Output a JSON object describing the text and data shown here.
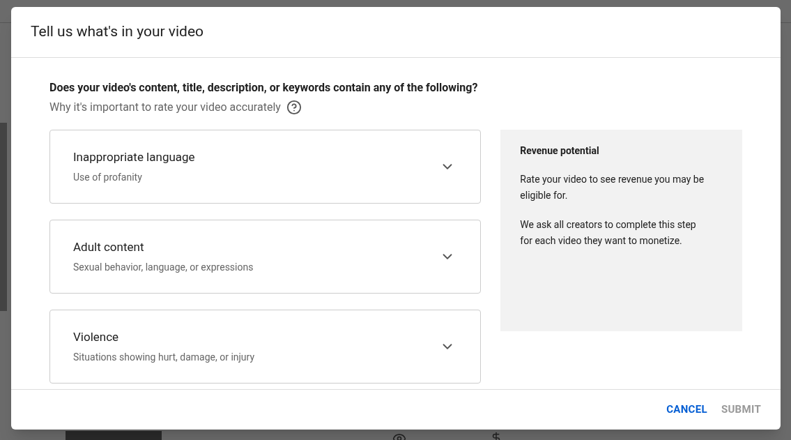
{
  "dialog": {
    "title": "Tell us what's in your video",
    "question": "Does your video's content, title, description, or keywords contain any of the following?",
    "help_link": "Why it's important to rate your video accurately",
    "categories": [
      {
        "title": "Inappropriate language",
        "subtitle": "Use of profanity",
        "expanded": false
      },
      {
        "title": "Adult content",
        "subtitle": "Sexual behavior, language, or expressions",
        "expanded": false
      },
      {
        "title": "Violence",
        "subtitle": "Situations showing hurt, damage, or injury",
        "expanded": false
      }
    ],
    "side_panel": {
      "title": "Revenue potential",
      "paragraphs": [
        "Rate your video to see revenue you may be eligible for.",
        "We ask all creators to complete this step for each video they want to monetize."
      ]
    },
    "buttons": [
      {
        "label": "CANCEL",
        "disabled": false
      },
      {
        "label": "SUBMIT",
        "disabled": true
      }
    ]
  }
}
